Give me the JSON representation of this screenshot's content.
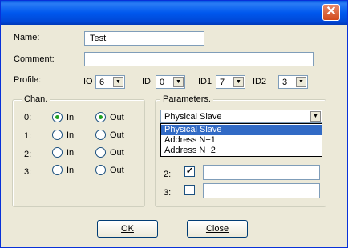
{
  "dialog": {
    "close_glyph": "✕"
  },
  "form": {
    "name_label": "Name:",
    "name_value": "Test",
    "comment_label": "Comment:",
    "comment_value": "",
    "profile_label": "Profile:",
    "io_label": "IO",
    "io_value": "6",
    "id_label": "ID",
    "id_value": "0",
    "id1_label": "ID1",
    "id1_value": "7",
    "id2_label": "ID2",
    "id2_value": "3"
  },
  "chan": {
    "title": "Chan.",
    "in_label": "In",
    "out_label": "Out",
    "rows": [
      {
        "label": "0:",
        "in_selected": true,
        "out_selected": true
      },
      {
        "label": "1:",
        "in_selected": false,
        "out_selected": false
      },
      {
        "label": "2:",
        "in_selected": false,
        "out_selected": false
      },
      {
        "label": "3:",
        "in_selected": false,
        "out_selected": false
      }
    ]
  },
  "parameters": {
    "title": "Parameters.",
    "selected": "Physical Slave",
    "options": [
      "Physical Slave",
      "Address N+1",
      "Address N+2"
    ],
    "rows": [
      {
        "label": "2:",
        "checked": true,
        "value": ""
      },
      {
        "label": "3:",
        "checked": false,
        "value": ""
      }
    ]
  },
  "buttons": {
    "ok": "OK",
    "close": "Close"
  },
  "colors": {
    "title_bar": "#0054e3",
    "dialog_bg": "#ece9d8",
    "selection": "#316ac5",
    "close_button": "#d24a1c"
  },
  "icons": {
    "close": "close-icon",
    "dropdown": "chevron-down-icon",
    "check": "checkmark-icon"
  }
}
